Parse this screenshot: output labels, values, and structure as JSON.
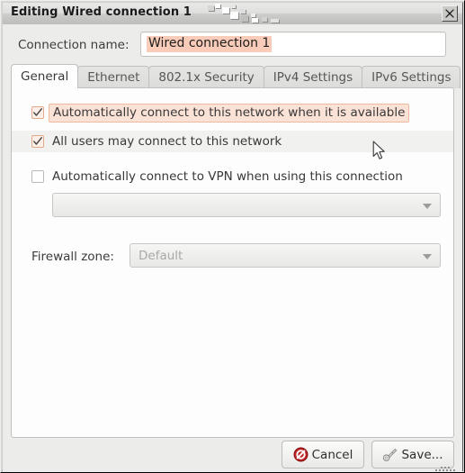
{
  "window": {
    "title": "Editing Wired connection 1",
    "close_icon": "close-icon",
    "titlebar_gradient_from": "#e9e9e7",
    "titlebar_gradient_to": "#bdbdbb"
  },
  "connection": {
    "name_label": "Connection name:",
    "name_value": "Wired connection 1",
    "name_placeholder": "Connection name",
    "selection_color": "#f8ccb8"
  },
  "tabs": [
    {
      "label": "General",
      "active": true
    },
    {
      "label": "Ethernet",
      "active": false
    },
    {
      "label": "802.1x Security",
      "active": false
    },
    {
      "label": "IPv4 Settings",
      "active": false
    },
    {
      "label": "IPv6 Settings",
      "active": false
    }
  ],
  "general": {
    "checkboxes": [
      {
        "label": "Automatically connect to this network when it is available",
        "checked": true,
        "focused": true
      },
      {
        "label": "All users may connect to this network",
        "checked": true,
        "focused": false
      },
      {
        "label": "Automatically connect to VPN when using this connection",
        "checked": false,
        "focused": false
      }
    ],
    "vpn_combo": {
      "value": "",
      "placeholder": "",
      "enabled": false,
      "arrow_icon": "chevron-down-icon"
    },
    "firewall": {
      "label": "Firewall zone:",
      "value": "Default",
      "enabled": false,
      "arrow_icon": "chevron-down-icon"
    }
  },
  "buttons": {
    "cancel": {
      "label": "Cancel",
      "icon": "cancel-icon",
      "icon_color": "#b71d1d"
    },
    "save": {
      "label": "Save...",
      "icon": "key-icon",
      "icon_color": "#9a9a97"
    }
  },
  "colors": {
    "dialog_bg": "#ececeb",
    "panel_bg": "#fdfdfd",
    "check_border": "#e0a98c",
    "focus_highlight": "#fbe2d6",
    "text": "#383838"
  }
}
